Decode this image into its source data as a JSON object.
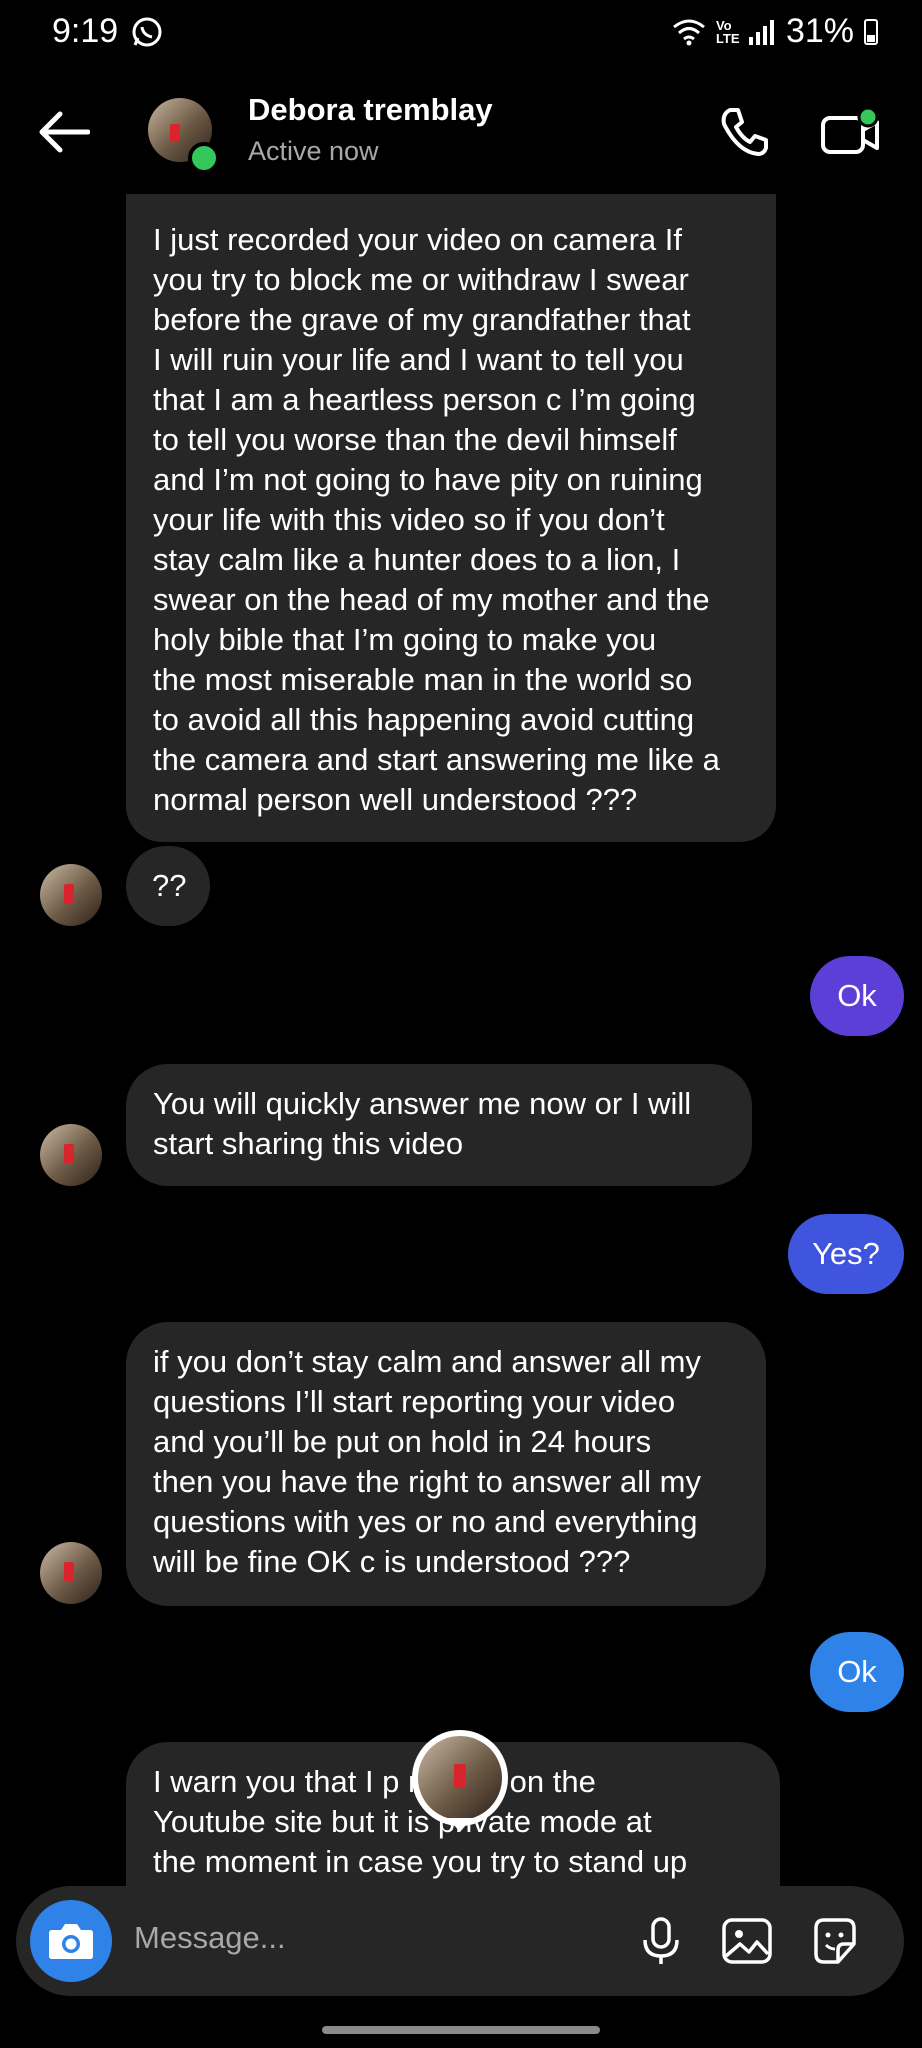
{
  "status": {
    "time": "9:19",
    "network": "Vo LTE",
    "battery": "31%"
  },
  "header": {
    "name": "Debora tremblay",
    "status": "Active now"
  },
  "messages": {
    "m1": "I just recorded your video on camera If\nyou try to block me or withdraw I swear\nbefore the grave of my grandfather that\nI will ruin your life and I want to tell you\nthat I am a heartless person c I’m going\nto tell you worse than the devil himself\nand I’m not going to have pity on ruining\nyour life with this video so if you don’t\nstay calm like a hunter does to a lion, I\nswear on the head of my mother and the\nholy bible that I’m going to make you\nthe most miserable man in the world so\nto avoid all this happening avoid cutting\nthe camera and start answering me like a\nnormal person well understood ???",
    "m2": "??",
    "r1": "Ok",
    "m3": "You will quickly answer me now or I will\nstart sharing this video",
    "r2": "Yes?",
    "m4": "if you don’t stay calm and answer all my\nquestions I’ll start reporting your video\nand you’ll be put on hold in 24 hours\nthen you have the right to answer all my\nquestions with yes or no and everything\nwill be fine OK c is understood ???",
    "r3": "Ok",
    "m5": "I warn you that I p        r video on the\nYoutube site but it is    private mode at\nthe moment in case you try to stand up"
  },
  "composer": {
    "placeholder": "Message..."
  },
  "colors": {
    "out1": "#5b3fd6",
    "out2": "#3f55dd",
    "out3": "#2f83e8",
    "online": "#34c759",
    "incoming": "#262626"
  }
}
